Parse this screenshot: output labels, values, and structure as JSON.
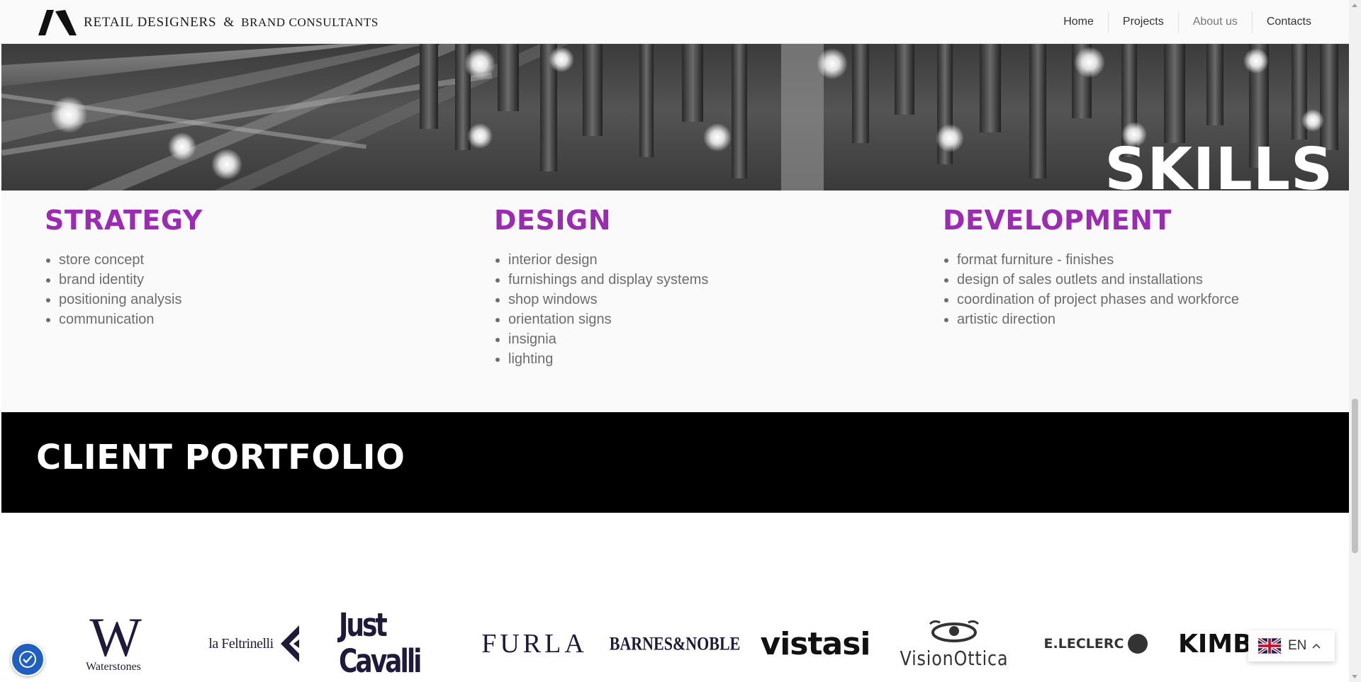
{
  "header": {
    "logo_big": "RETAIL DESIGNERS",
    "logo_amp": "&",
    "logo_small": "BRAND CONSULTANTS",
    "nav": [
      {
        "label": "Home"
      },
      {
        "label": "Projects"
      },
      {
        "label": "About us",
        "active": true
      },
      {
        "label": "Contacts"
      }
    ]
  },
  "hero": {
    "title": "SKILLS"
  },
  "skills": [
    {
      "heading": "STRATEGY",
      "items": [
        "store concept",
        "brand identity",
        "positioning analysis",
        "communication"
      ]
    },
    {
      "heading": "DESIGN",
      "items": [
        "interior design",
        "furnishings and display systems",
        "shop windows",
        "orientation signs",
        "insignia",
        "lighting"
      ]
    },
    {
      "heading": "DEVELOPMENT",
      "items": [
        "format furniture - finishes",
        "design of sales outlets and installations",
        "coordination of project phases and workforce",
        "artistic direction"
      ]
    }
  ],
  "portfolio": {
    "title": "CLIENT PORTFOLIO",
    "clients": [
      "Waterstones",
      "la Feltrinelli",
      "Just Cavalli",
      "FURLA",
      "BARNES&NOBLE",
      "vistasi",
      "VisionOttica",
      "E.LECLERC",
      "KIMBO"
    ]
  },
  "language": {
    "code": "EN"
  },
  "colors": {
    "accent": "#9b2bb0",
    "band": "#000000",
    "a11y": "#1e5fbf"
  }
}
